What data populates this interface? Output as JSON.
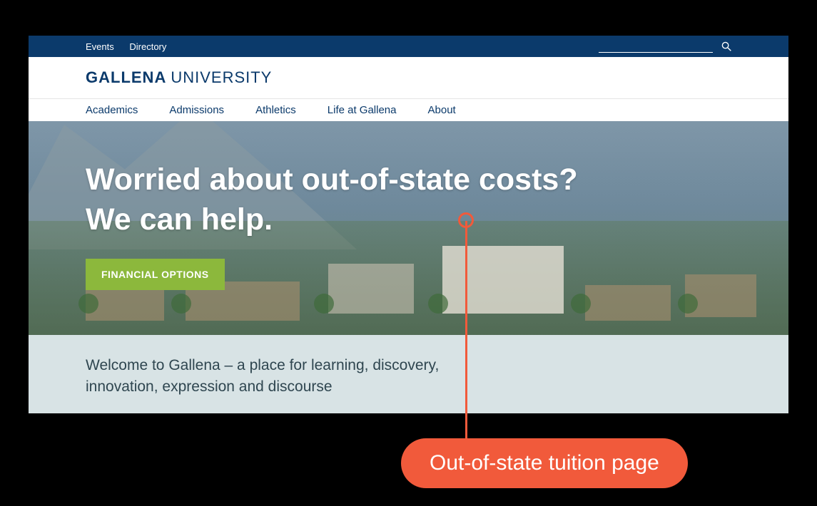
{
  "util_nav": {
    "links": [
      "Events",
      "Directory"
    ]
  },
  "logo": {
    "bold": "GALLENA",
    "light": "UNIVERSITY"
  },
  "main_nav": [
    "Academics",
    "Admissions",
    "Athletics",
    "Life at Gallena",
    "About"
  ],
  "hero": {
    "title_line1": "Worried about out-of-state costs?",
    "title_line2": "We can help.",
    "button_label": "FINANCIAL OPTIONS"
  },
  "welcome": {
    "text": "Welcome to Gallena – a place for learning, discovery, innovation, expression and discourse"
  },
  "callout": {
    "label": "Out-of-state tuition page"
  },
  "colors": {
    "brand_navy": "#0b3a6b",
    "accent_green": "#8cb83c",
    "callout_orange": "#f15a3b",
    "welcome_bg": "#d8e3e5"
  }
}
